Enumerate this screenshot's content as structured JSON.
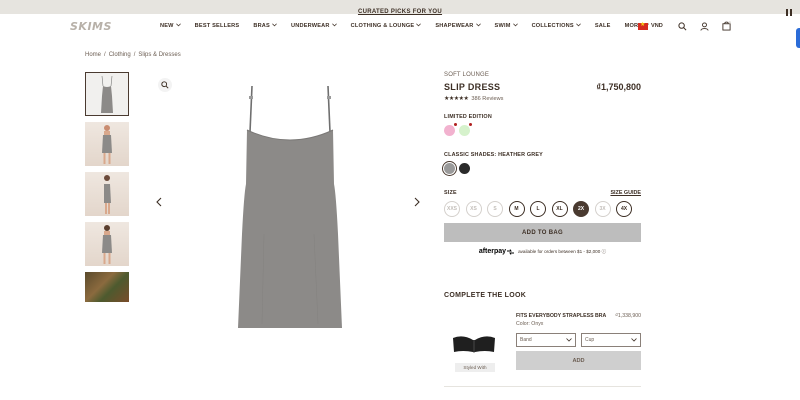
{
  "promo": {
    "text": "CURATED PICKS FOR YOU"
  },
  "brand": {
    "logo": "SKIMS"
  },
  "nav": {
    "items": [
      {
        "label": "NEW",
        "dropdown": true
      },
      {
        "label": "BEST SELLERS",
        "dropdown": false
      },
      {
        "label": "BRAS",
        "dropdown": true
      },
      {
        "label": "UNDERWEAR",
        "dropdown": true
      },
      {
        "label": "CLOTHING & LOUNGE",
        "dropdown": true
      },
      {
        "label": "SHAPEWEAR",
        "dropdown": true
      },
      {
        "label": "SWIM",
        "dropdown": true
      },
      {
        "label": "COLLECTIONS",
        "dropdown": true
      },
      {
        "label": "SALE",
        "dropdown": false
      },
      {
        "label": "MORE",
        "dropdown": true
      }
    ],
    "currency": "VND",
    "icons": [
      "search-icon",
      "account-icon",
      "bag-icon"
    ]
  },
  "breadcrumb": [
    "Home",
    "Clothing",
    "Slips & Dresses"
  ],
  "product": {
    "collection": "SOFT LOUNGE",
    "title": "SLIP DRESS",
    "price": "₫1,750,800",
    "stars": "★★★★★",
    "reviews": "386 Reviews",
    "limited_label": "LIMITED EDITION",
    "limited_swatches": [
      {
        "color": "#f2b2cf",
        "new": true
      },
      {
        "color": "#d6f2cc",
        "new": true
      }
    ],
    "classic_label": "CLASSIC SHADES: HEATHER GREY",
    "classic_swatches": [
      {
        "color": "#9a9a9a",
        "selected": true
      },
      {
        "color": "#2a2a2a",
        "selected": false
      }
    ],
    "size_label": "SIZE",
    "size_guide": "SIZE GUIDE",
    "sizes": [
      {
        "label": "XXS",
        "available": false
      },
      {
        "label": "XS",
        "available": false
      },
      {
        "label": "S",
        "available": false
      },
      {
        "label": "M",
        "available": true
      },
      {
        "label": "L",
        "available": true
      },
      {
        "label": "XL",
        "available": true
      },
      {
        "label": "2X",
        "available": true,
        "selected": true
      },
      {
        "label": "3X",
        "available": false
      },
      {
        "label": "4X",
        "available": true
      }
    ],
    "add_to_bag": "ADD TO BAG",
    "afterpay_logo": "afterpay",
    "afterpay_text": "available for orders between $1 - $2,000 ⓘ"
  },
  "complete_look": {
    "title": "COMPLETE THE LOOK",
    "styled_with": "Styled With",
    "item_name": "FITS EVERYBODY STRAPLESS BRA",
    "item_price": "₫1,338,900",
    "item_color": "Color: Onyx",
    "band_placeholder": "Band",
    "cup_placeholder": "Cup",
    "add": "ADD"
  },
  "colors": {
    "text": "#3d2f25",
    "dress": "#8c8a88",
    "selected_size_bg": "#4a3a30"
  }
}
